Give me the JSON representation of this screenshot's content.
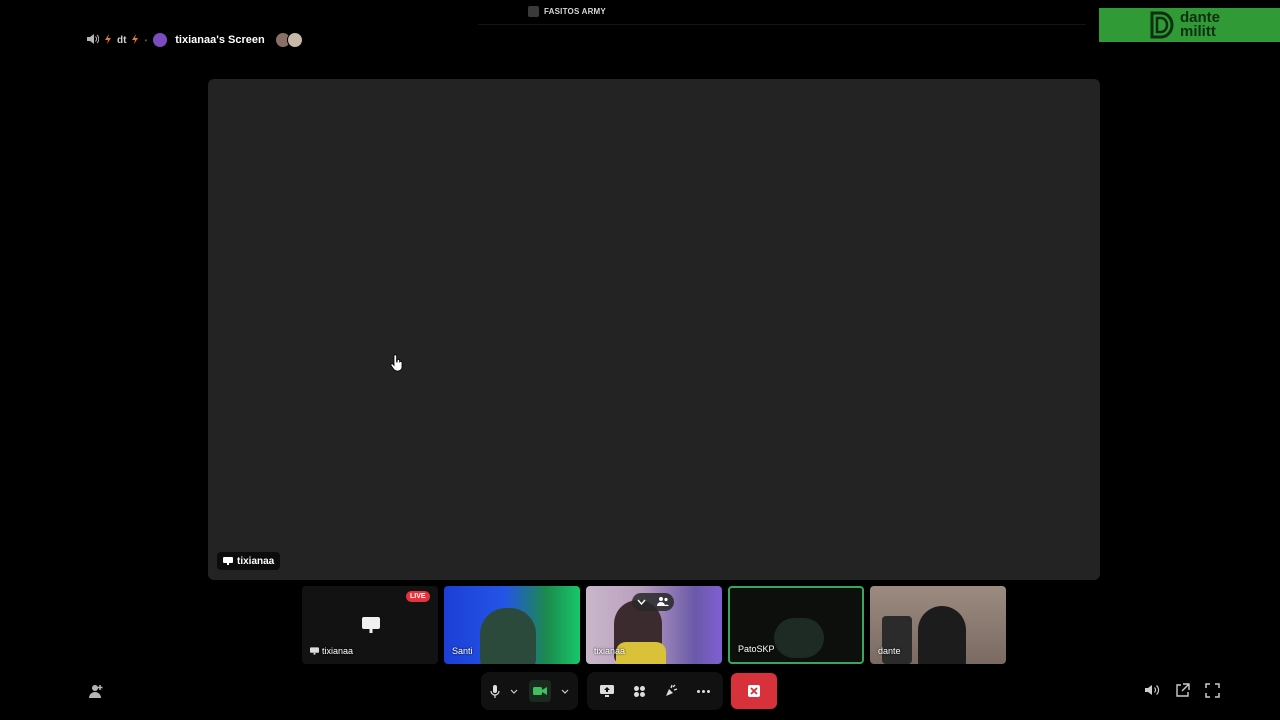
{
  "server": {
    "name": "FASITOS ARMY"
  },
  "logo": {
    "line1": "dante",
    "line2": "militt"
  },
  "header": {
    "channel_short": "dt",
    "stream_title": "tixianaa's Screen"
  },
  "stage": {
    "streamer_label": "tixianaa"
  },
  "tiles": [
    {
      "name": "tixianaa",
      "live_label": "LIVE"
    },
    {
      "name": "Santi"
    },
    {
      "name": "tixianaa"
    },
    {
      "name": "PatoSKP"
    },
    {
      "name": "dante"
    }
  ],
  "icons": {
    "volume": "volume-icon",
    "mic": "mic-icon",
    "camera": "camera-icon",
    "share": "share-screen-icon",
    "activities": "activities-icon",
    "soundboard": "soundboard-icon",
    "more": "more-icon",
    "hangup": "hangup-icon",
    "popout": "popout-icon",
    "fullscreen": "fullscreen-icon",
    "invite": "add-user-icon"
  },
  "colors": {
    "live": "#e5333d",
    "hangup": "#d7313c",
    "speaking_border": "#3aa55d",
    "logo_bg": "#2f9a36"
  }
}
